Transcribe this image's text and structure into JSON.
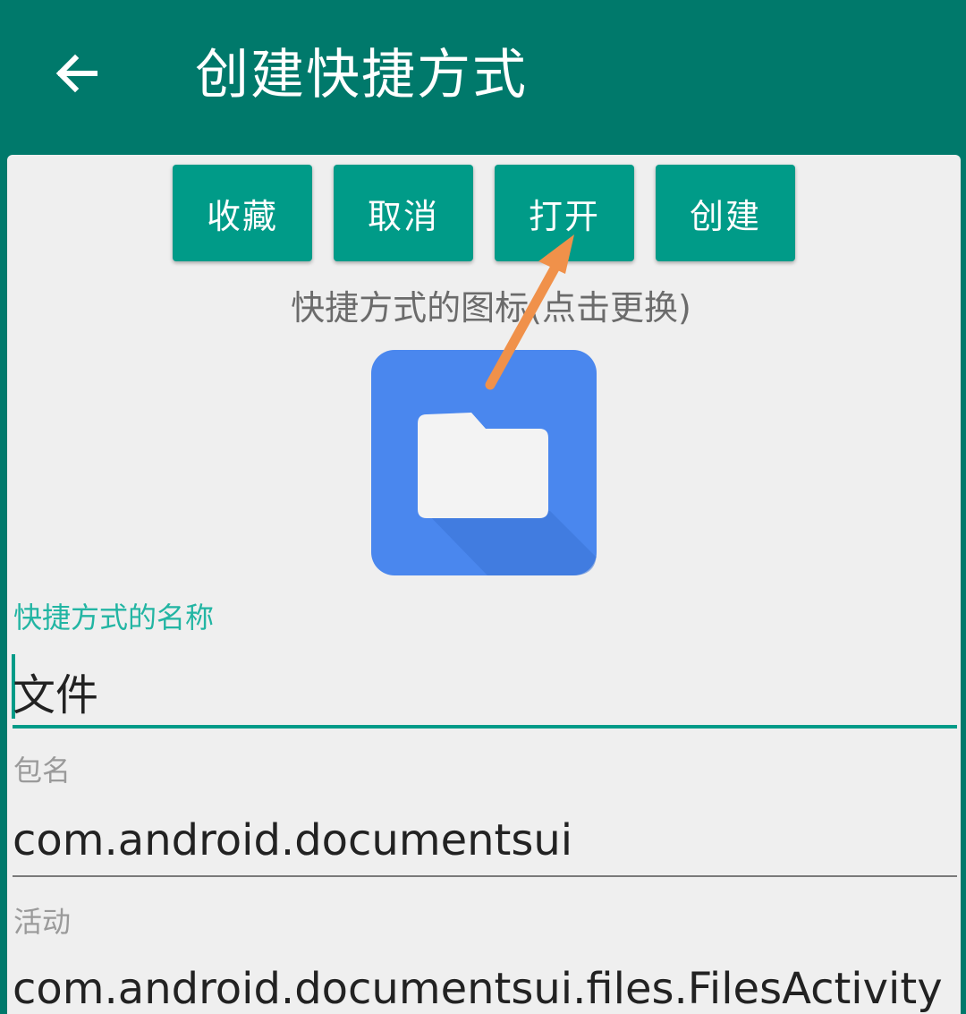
{
  "appbar": {
    "title": "创建快捷方式",
    "back_icon": "arrow-left-icon"
  },
  "actions": {
    "favorite_label": "收藏",
    "cancel_label": "取消",
    "open_label": "打开",
    "create_label": "创建"
  },
  "icon_section": {
    "caption": "快捷方式的图标(点击更换)",
    "icon_name": "folder-icon"
  },
  "fields": {
    "name": {
      "label": "快捷方式的名称",
      "value": "文件"
    },
    "package": {
      "label": "包名",
      "value": "com.android.documentsui"
    },
    "activity": {
      "label": "活动",
      "value": "com.android.documentsui.files.FilesActivity"
    }
  },
  "colors": {
    "primary": "#00796b",
    "accent": "#009b88",
    "annotation_arrow": "#f0914a"
  }
}
